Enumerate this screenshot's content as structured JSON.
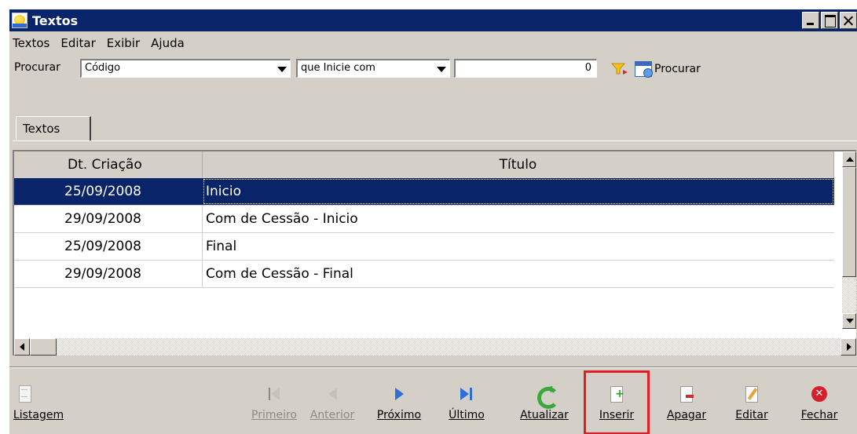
{
  "window": {
    "title": "Textos"
  },
  "menu": [
    {
      "label": "Textos"
    },
    {
      "label": "Editar"
    },
    {
      "label": "Exibir"
    },
    {
      "label": "Ajuda"
    }
  ],
  "search": {
    "label": "Procurar",
    "field_value": "Código",
    "condition_value": "que Inicie com",
    "input_value": "0",
    "button_label": "Procurar"
  },
  "tab": {
    "label": "Textos"
  },
  "table": {
    "columns": [
      "Dt. Criação",
      "Título"
    ],
    "rows": [
      {
        "date": "25/09/2008",
        "title": "Inicio",
        "selected": true
      },
      {
        "date": "29/09/2008",
        "title": "Com de Cessão - Inicio"
      },
      {
        "date": "25/09/2008",
        "title": "Final"
      },
      {
        "date": "29/09/2008",
        "title": "Com de Cessão - Final"
      }
    ]
  },
  "toolbar": {
    "listagem": "Listagem",
    "primeiro": "Primeiro",
    "anterior": "Anterior",
    "proximo": "Próximo",
    "ultimo": "Último",
    "atualizar": "Atualizar",
    "inserir": "Inserir",
    "apagar": "Apagar",
    "editar": "Editar",
    "fechar": "Fechar"
  },
  "colors": {
    "titlebar": "#0a246a",
    "selection": "#0a246a",
    "highlight": "#e31b23",
    "window_bg": "#d4d0c8"
  }
}
